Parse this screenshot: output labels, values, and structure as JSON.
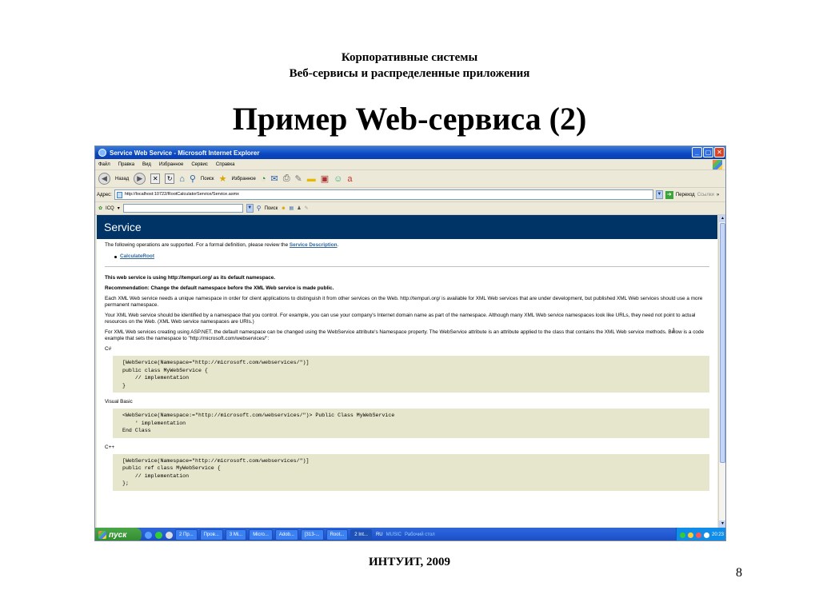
{
  "slide": {
    "header_line1": "Корпоративные системы",
    "header_line2": "Веб-сервисы и распределенные приложения",
    "title": "Пример Web-сервиса (2)",
    "footer": "ИНТУИТ, 2009",
    "page_number": "8"
  },
  "window": {
    "title": "Service Web Service - Microsoft Internet Explorer",
    "minimize": "_",
    "maximize": "▢",
    "close": "✕"
  },
  "menu": [
    "Файл",
    "Правка",
    "Вид",
    "Избранное",
    "Сервис",
    "Справка"
  ],
  "toolbar": {
    "back_label": "Назад",
    "search_label": "Поиск",
    "favorites_label": "Избранное"
  },
  "address": {
    "label": "Адрес:",
    "url": "http://localhost:10722/RootCalculatorService/Service.asmx",
    "go_label": "Переход",
    "links_label": "Ссылки"
  },
  "links_bar": {
    "icq_label": "ICQ",
    "search_label": "Поиск"
  },
  "page": {
    "service_name": "Service",
    "intro_prefix": "The following operations are supported. For a formal definition, please review the ",
    "intro_link": "Service Description",
    "intro_suffix": ".",
    "operation": "CalculateRoot",
    "namespace_notice": "This web service is using http://tempuri.org/ as its default namespace.",
    "recommendation": "Recommendation: Change the default namespace before the XML Web service is made public.",
    "para1": "Each XML Web service needs a unique namespace in order for client applications to distinguish it from other services on the Web. http://tempuri.org/ is available for XML Web services that are under development, but published XML Web services should use a more permanent namespace.",
    "para2": "Your XML Web service should be identified by a namespace that you control. For example, you can use your company's Internet domain name as part of the namespace. Although many XML Web service namespaces look like URLs, they need not point to actual resources on the Web. (XML Web service namespaces are URIs.)",
    "para3": "For XML Web services creating using ASP.NET, the default namespace can be changed using the WebService attribute's Namespace property. The WebService attribute is an attribute applied to the class that contains the XML Web service methods. Below is a code example that sets the namespace to \"http://microsoft.com/webservices/\":",
    "lang_csharp": "C#",
    "code_csharp": "[WebService(Namespace=\"http://microsoft.com/webservices/\")]\npublic class MyWebService {\n    // implementation\n}",
    "lang_vb": "Visual Basic",
    "code_vb": "<WebService(Namespace:=\"http://microsoft.com/webservices/\")> Public Class MyWebService\n    ' implementation\nEnd Class",
    "lang_cpp": "C++",
    "code_cpp": "[WebService(Namespace=\"http://microsoft.com/webservices/\")]\npublic ref class MyWebService {\n    // implementation\n};"
  },
  "taskbar": {
    "start_label": "пуск",
    "tasks": [
      "2 Пр...",
      "Пров...",
      "3 Mi...",
      "Micro...",
      "Adob...",
      "[313-...",
      "Root...",
      "2 Int..."
    ],
    "lang": "RU",
    "music": "MUSIC",
    "desktop": "Рабочий стол",
    "clock": "20:23"
  }
}
